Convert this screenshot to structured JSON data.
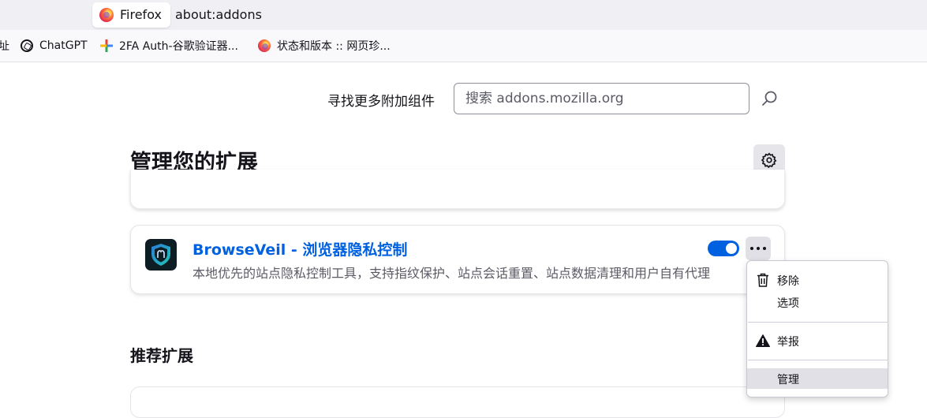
{
  "urlbar": {
    "identity_label": "Firefox",
    "url": "about:addons"
  },
  "bookmarks": [
    {
      "label": "址",
      "icon": "none"
    },
    {
      "label": "ChatGPT",
      "icon": "chatgpt-icon"
    },
    {
      "label": "2FA Auth-谷歌验证器...",
      "icon": "pinwheel-icon"
    },
    {
      "label": "状态和版本 :: 网页珍...",
      "icon": "firefox-icon"
    }
  ],
  "search": {
    "label": "寻找更多附加组件",
    "placeholder": "搜索 addons.mozilla.org"
  },
  "page": {
    "title": "管理您的扩展",
    "recommended_title": "推荐扩展"
  },
  "extension": {
    "name": "BrowseVeil - 浏览器隐私控制",
    "description": "本地优先的站点隐私控制工具，支持指纹保护、站点会话重置、站点数据清理和用户自有代理",
    "enabled": true
  },
  "context_menu": {
    "remove": "移除",
    "options": "选项",
    "report": "举报",
    "manage": "管理"
  },
  "colors": {
    "accent": "#0061e0",
    "urlbar_bg": "#f0f0f4",
    "menu_hover": "#e0e0e6"
  }
}
